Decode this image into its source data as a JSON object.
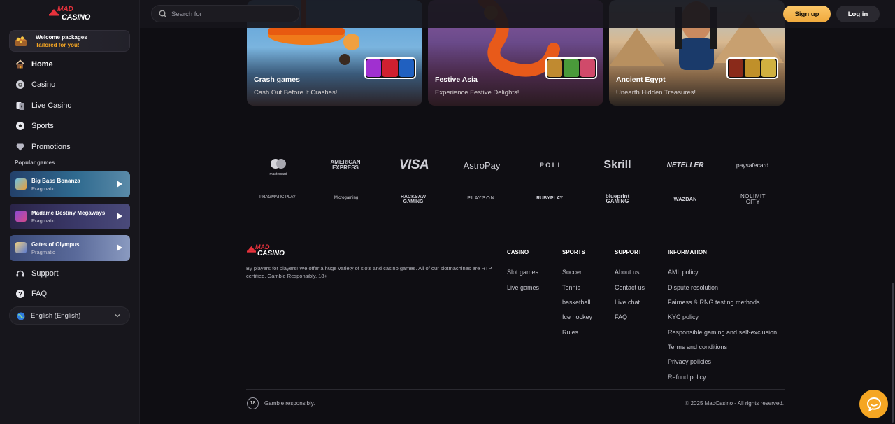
{
  "brand": {
    "logo_top": "MAD",
    "logo_bottom": "CASINO"
  },
  "sidebar": {
    "welcome": {
      "title": "Welcome packages",
      "subtitle": "Tailored for you!"
    },
    "nav": [
      {
        "label": "Home",
        "icon": "home-icon"
      },
      {
        "label": "Casino",
        "icon": "casino-chip-icon"
      },
      {
        "label": "Live Casino",
        "icon": "cards-icon"
      },
      {
        "label": "Sports",
        "icon": "soccer-ball-icon"
      },
      {
        "label": "Promotions",
        "icon": "diamond-icon"
      }
    ],
    "popular_title": "Popular games",
    "games": [
      {
        "name": "Big Bass Bonanza",
        "provider": "Pragmatic"
      },
      {
        "name": "Madame Destiny Megaways",
        "provider": "Pragmatic"
      },
      {
        "name": "Gates of Olympus",
        "provider": "Pragmatic"
      }
    ],
    "support": {
      "label": "Support",
      "icon": "headset-icon"
    },
    "faq": {
      "label": "FAQ",
      "icon": "question-icon"
    },
    "language": "English (English)"
  },
  "header": {
    "search_placeholder": "Search for",
    "signup_label": "Sign up",
    "login_label": "Log in"
  },
  "categories": [
    {
      "title": "Crash games",
      "subtitle": "Cash Out Before It Crashes!",
      "tag1": "PLINKO",
      "tag2": "VIAI",
      "tag3": "Mi Mines"
    },
    {
      "title": "Festive Asia",
      "subtitle": "Experience Festive Delights!"
    },
    {
      "title": "Ancient Egypt",
      "subtitle": "Unearth Hidden Treasures!",
      "tag2": "BOOK OF MYSTERIES"
    }
  ],
  "payments": [
    "mastercard",
    "AMERICAN EXPRESS",
    "VISA",
    "AstroPay",
    "P O L I",
    "Skrill",
    "NETELLER",
    "paysafecard"
  ],
  "providers": [
    "PRAGMATIC PLAY",
    "Microgaming",
    "HACKSAW GAMING",
    "PLAYSON",
    "RUBYPLAY",
    "blueprint GAMING",
    "WAZDAN",
    "NOLIMIT CITY"
  ],
  "footer": {
    "description": "By players for players! We offer a huge variety of slots and casino games. All of our slotmachines are RTP certified. Gamble Responsibly. 18+",
    "columns": [
      {
        "heading": "CASINO",
        "links": [
          "Slot games",
          "Live games"
        ]
      },
      {
        "heading": "SPORTS",
        "links": [
          "Soccer",
          "Tennis",
          "basketball",
          "Ice hockey",
          "Rules"
        ]
      },
      {
        "heading": "SUPPORT",
        "links": [
          "About us",
          "Contact us",
          "Live chat",
          "FAQ"
        ]
      },
      {
        "heading": "INFORMATION",
        "links": [
          "AML policy",
          "Dispute resolution",
          "Fairness & RNG testing methods",
          "KYC policy",
          "Responsible gaming and self-exclusion",
          "Terms and conditions",
          "Privacy policies",
          "Refund policy"
        ]
      }
    ],
    "age_badge": "18",
    "gamble_text": "Gamble responsibly.",
    "copyright": "© 2025 MadCasino - All rights reserved."
  },
  "colors": {
    "accent": "#f5a623",
    "brand_red": "#e8323c",
    "background": "#0f0e13",
    "sidebar": "#17161c"
  }
}
